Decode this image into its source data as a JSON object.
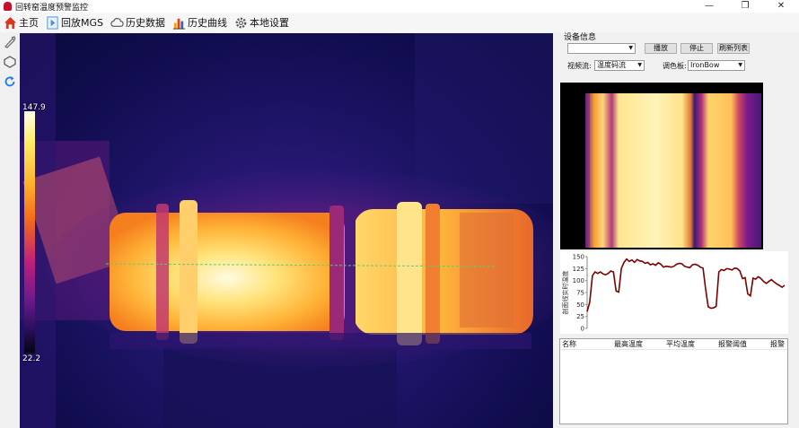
{
  "window": {
    "title": "回转窑温度预警监控",
    "minimize": "—",
    "maximize": "❐",
    "close": "✕"
  },
  "toolbar": {
    "home": "主页",
    "playback": "回放MGS",
    "history_data": "历史数据",
    "history_curve": "历史曲线",
    "local_settings": "本地设置"
  },
  "thermal": {
    "max_temp": "147.9",
    "min_temp": "22.2"
  },
  "device": {
    "group_title": "设备信息",
    "device_select": "",
    "play_button": "播放",
    "stop_button": "停止",
    "refresh_button": "刷新列表",
    "stream_label": "视频流:",
    "stream_value": "温度码流",
    "palette_label": "调色板:",
    "palette_value": "IronBow"
  },
  "chart_data": {
    "type": "line",
    "title": "",
    "ylabel": "剖面线实时温度",
    "ylim": [
      0,
      150
    ],
    "yticks": [
      0,
      25,
      50,
      75,
      100,
      125,
      150
    ],
    "y": [
      35,
      55,
      110,
      118,
      115,
      118,
      114,
      112,
      115,
      120,
      118,
      78,
      76,
      125,
      138,
      145,
      140,
      143,
      138,
      144,
      141,
      140,
      136,
      138,
      133,
      135,
      132,
      137,
      134,
      128,
      130,
      129,
      128,
      130,
      134,
      136,
      135,
      130,
      128,
      127,
      133,
      134,
      132,
      128,
      126,
      82,
      45,
      42,
      43,
      46,
      118,
      123,
      121,
      125,
      124,
      122,
      126,
      125,
      120,
      104,
      106,
      72,
      68,
      105,
      103,
      108,
      104,
      98,
      94,
      98,
      102,
      97,
      93,
      90,
      86,
      90
    ],
    "line_color": "#7b0000"
  },
  "table": {
    "columns": [
      "名称",
      "最高温度",
      "平均温度",
      "报警阈值",
      "报警"
    ]
  }
}
